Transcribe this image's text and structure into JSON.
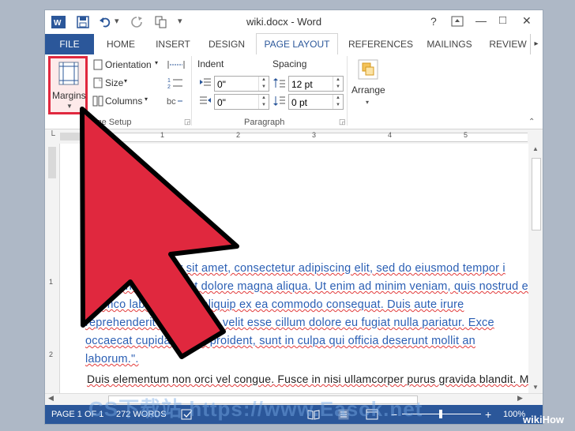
{
  "titlebar": {
    "title": "wiki.docx - Word",
    "help": "?",
    "minimize": "—",
    "maximize": "□",
    "close": "✕",
    "undo_dropdown": "▾",
    "qat_more": "▾"
  },
  "tabs": {
    "file": "FILE",
    "items": [
      "HOME",
      "INSERT",
      "DESIGN",
      "PAGE LAYOUT",
      "REFERENCES",
      "MAILINGS",
      "REVIEW"
    ],
    "active": "PAGE LAYOUT",
    "scroll_right": "▸"
  },
  "ribbon": {
    "margins": "Margins",
    "orientation": "Orientation",
    "size": "Size",
    "columns": "Columns",
    "page_setup_group": "Page Setup",
    "indent_label": "Indent",
    "spacing_label": "Spacing",
    "indent_left": "0\"",
    "indent_right": "0\"",
    "spacing_before": "12 pt",
    "spacing_after": "0 pt",
    "paragraph_group": "Paragraph",
    "arrange": "Arrange"
  },
  "ruler": {
    "top_marks": [
      "1",
      "2",
      "3",
      "4",
      "5"
    ],
    "left_marks": [
      "1",
      "2"
    ]
  },
  "document": {
    "lines": [
      "Lorem ipsum dolor sit amet, consectetur adipiscing elit, sed do eiusmod tempor i",
      "incididunt ut labore et dolore magna aliqua. Ut enim ad minim veniam, quis nostrud ex",
      "ullamco laboris nisi ut aliquip ex ea commodo consequat. Duis aute irure",
      "reprehenderit in voluptate velit esse cillum dolore eu fugiat nulla pariatur. Exce",
      "occaecat cupidatat non proident, sunt in culpa qui officia deserunt mollit an",
      "laborum.\".",
      "Duis elementum non orci vel congue. Fusce in nisi ullamcorper purus gravida blandit. M"
    ]
  },
  "statusbar": {
    "page": "PAGE 1 OF 1",
    "words": "272 WORDS",
    "zoom": "100%",
    "zoom_minus": "−",
    "zoom_plus": "+"
  },
  "overlay": {
    "watermark": "CS下载站 https://www.Easck.net",
    "brand": "wikiHow"
  },
  "colors": {
    "accent": "#2b579a",
    "arrow_fill": "#e0283e",
    "highlight_box": "#e0283e"
  }
}
